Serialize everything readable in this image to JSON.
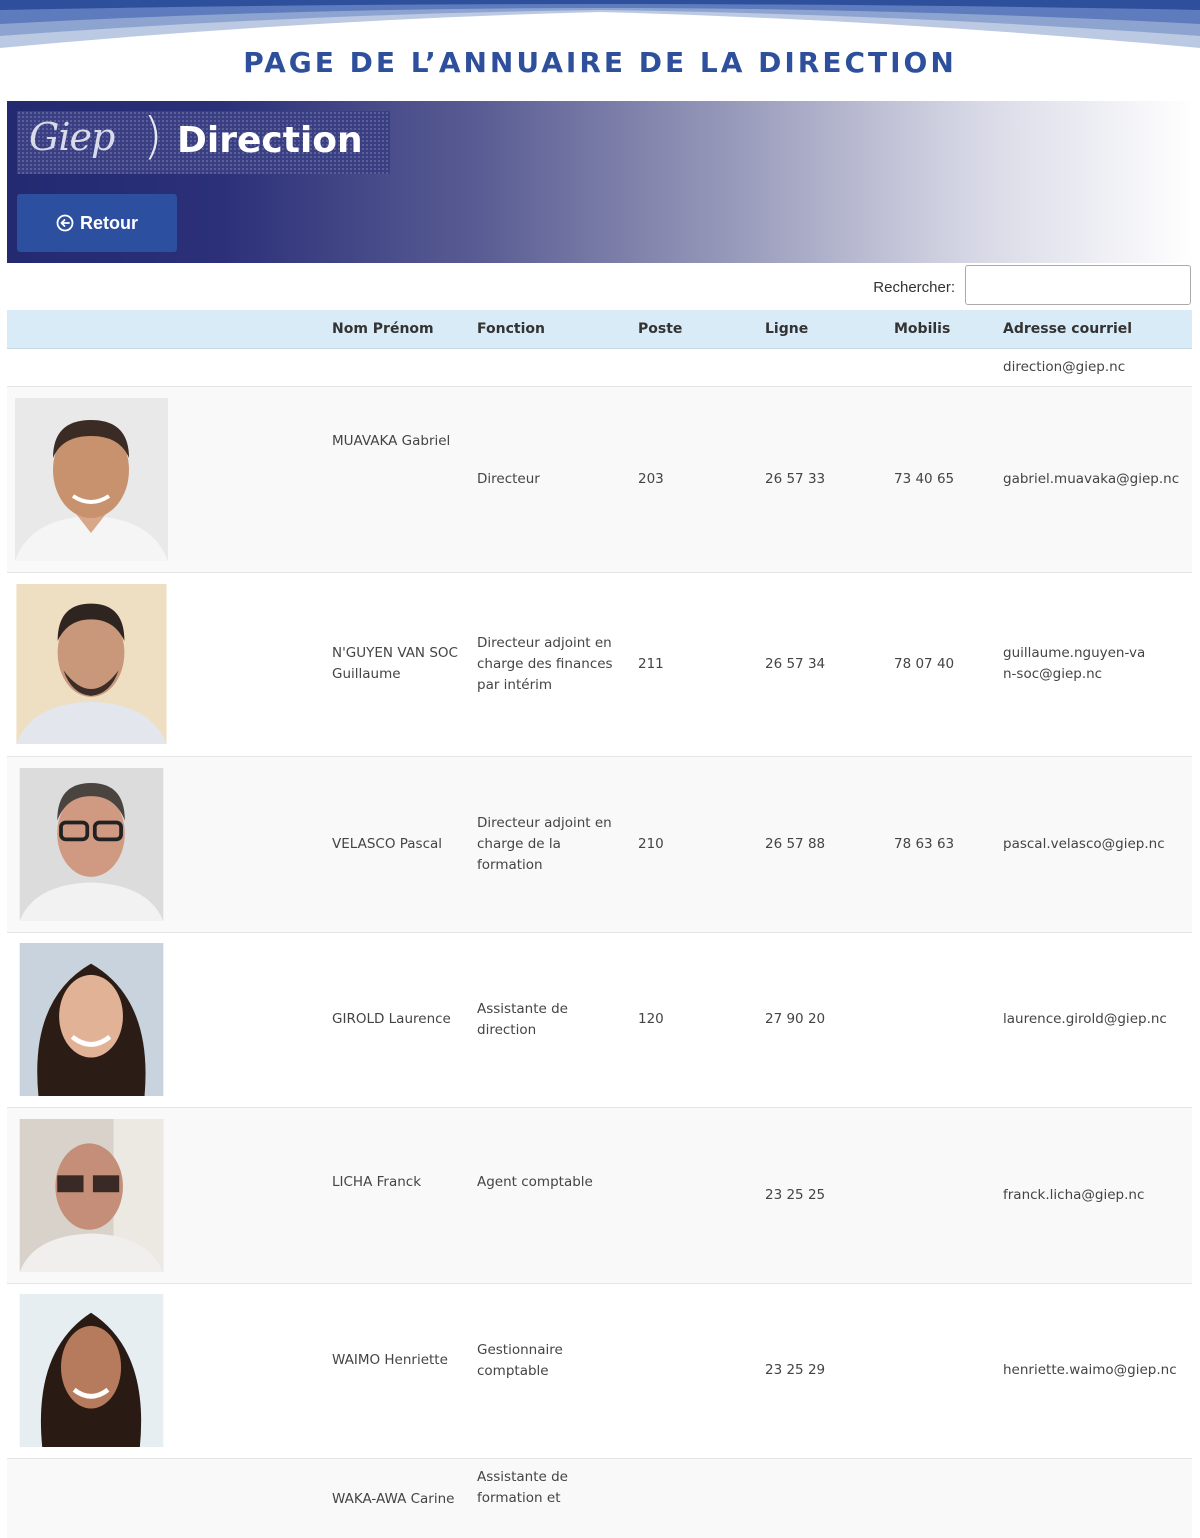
{
  "page_title": "PAGE DE L’ANNUAIRE DE LA DIRECTION",
  "banner": {
    "logo_mark": "Giep",
    "logo_text": "Direction",
    "back_label": "Retour"
  },
  "search": {
    "label": "Rechercher:",
    "value": ""
  },
  "table": {
    "headers": [
      "",
      "Nom Prénom",
      "Fonction",
      "Poste",
      "Ligne",
      "Mobilis",
      "Adresse courriel"
    ],
    "general_email": "direction@giep.nc",
    "rows": [
      {
        "nom": "MUAVAKA Gabriel",
        "fonction": "Directeur",
        "poste": "203",
        "ligne": "26 57 33",
        "mobilis": "73 40 65",
        "email": "gabriel.muavaka@giep.nc"
      },
      {
        "nom": "N'GUYEN VAN SOC Guillaume",
        "fonction": "Directeur adjoint en charge des finances par intérim",
        "poste": "211",
        "ligne": "26 57 34",
        "mobilis": "78 07 40",
        "email": "guillaume.nguyen-van-soc@giep.nc"
      },
      {
        "nom": "VELASCO Pascal",
        "fonction": "Directeur adjoint en charge de la formation",
        "poste": "210",
        "ligne": "26 57 88",
        "mobilis": "78 63 63",
        "email": "pascal.velasco@giep.nc"
      },
      {
        "nom": "GIROLD Laurence",
        "fonction": "Assistante de direction",
        "poste": "120",
        "ligne": "27 90 20",
        "mobilis": "",
        "email": "laurence.girold@giep.nc"
      },
      {
        "nom": "LICHA Franck",
        "fonction": "Agent comptable",
        "poste": "",
        "ligne": "23 25 25",
        "mobilis": "",
        "email": "franck.licha@giep.nc"
      },
      {
        "nom": "WAIMO Henriette",
        "fonction": "Gestionnaire comptable",
        "poste": "",
        "ligne": "23 25 29",
        "mobilis": "",
        "email": "henriette.waimo@giep.nc"
      },
      {
        "nom": "WAKA-AWA Carine",
        "fonction": "Assistante de formation et",
        "poste": "",
        "ligne": "",
        "mobilis": "",
        "email": ""
      }
    ]
  },
  "colors": {
    "title_blue": "#2d4f9c",
    "banner_dark": "#232a70",
    "button_blue": "#2c4fa0",
    "header_bg": "#d8ebf6"
  }
}
